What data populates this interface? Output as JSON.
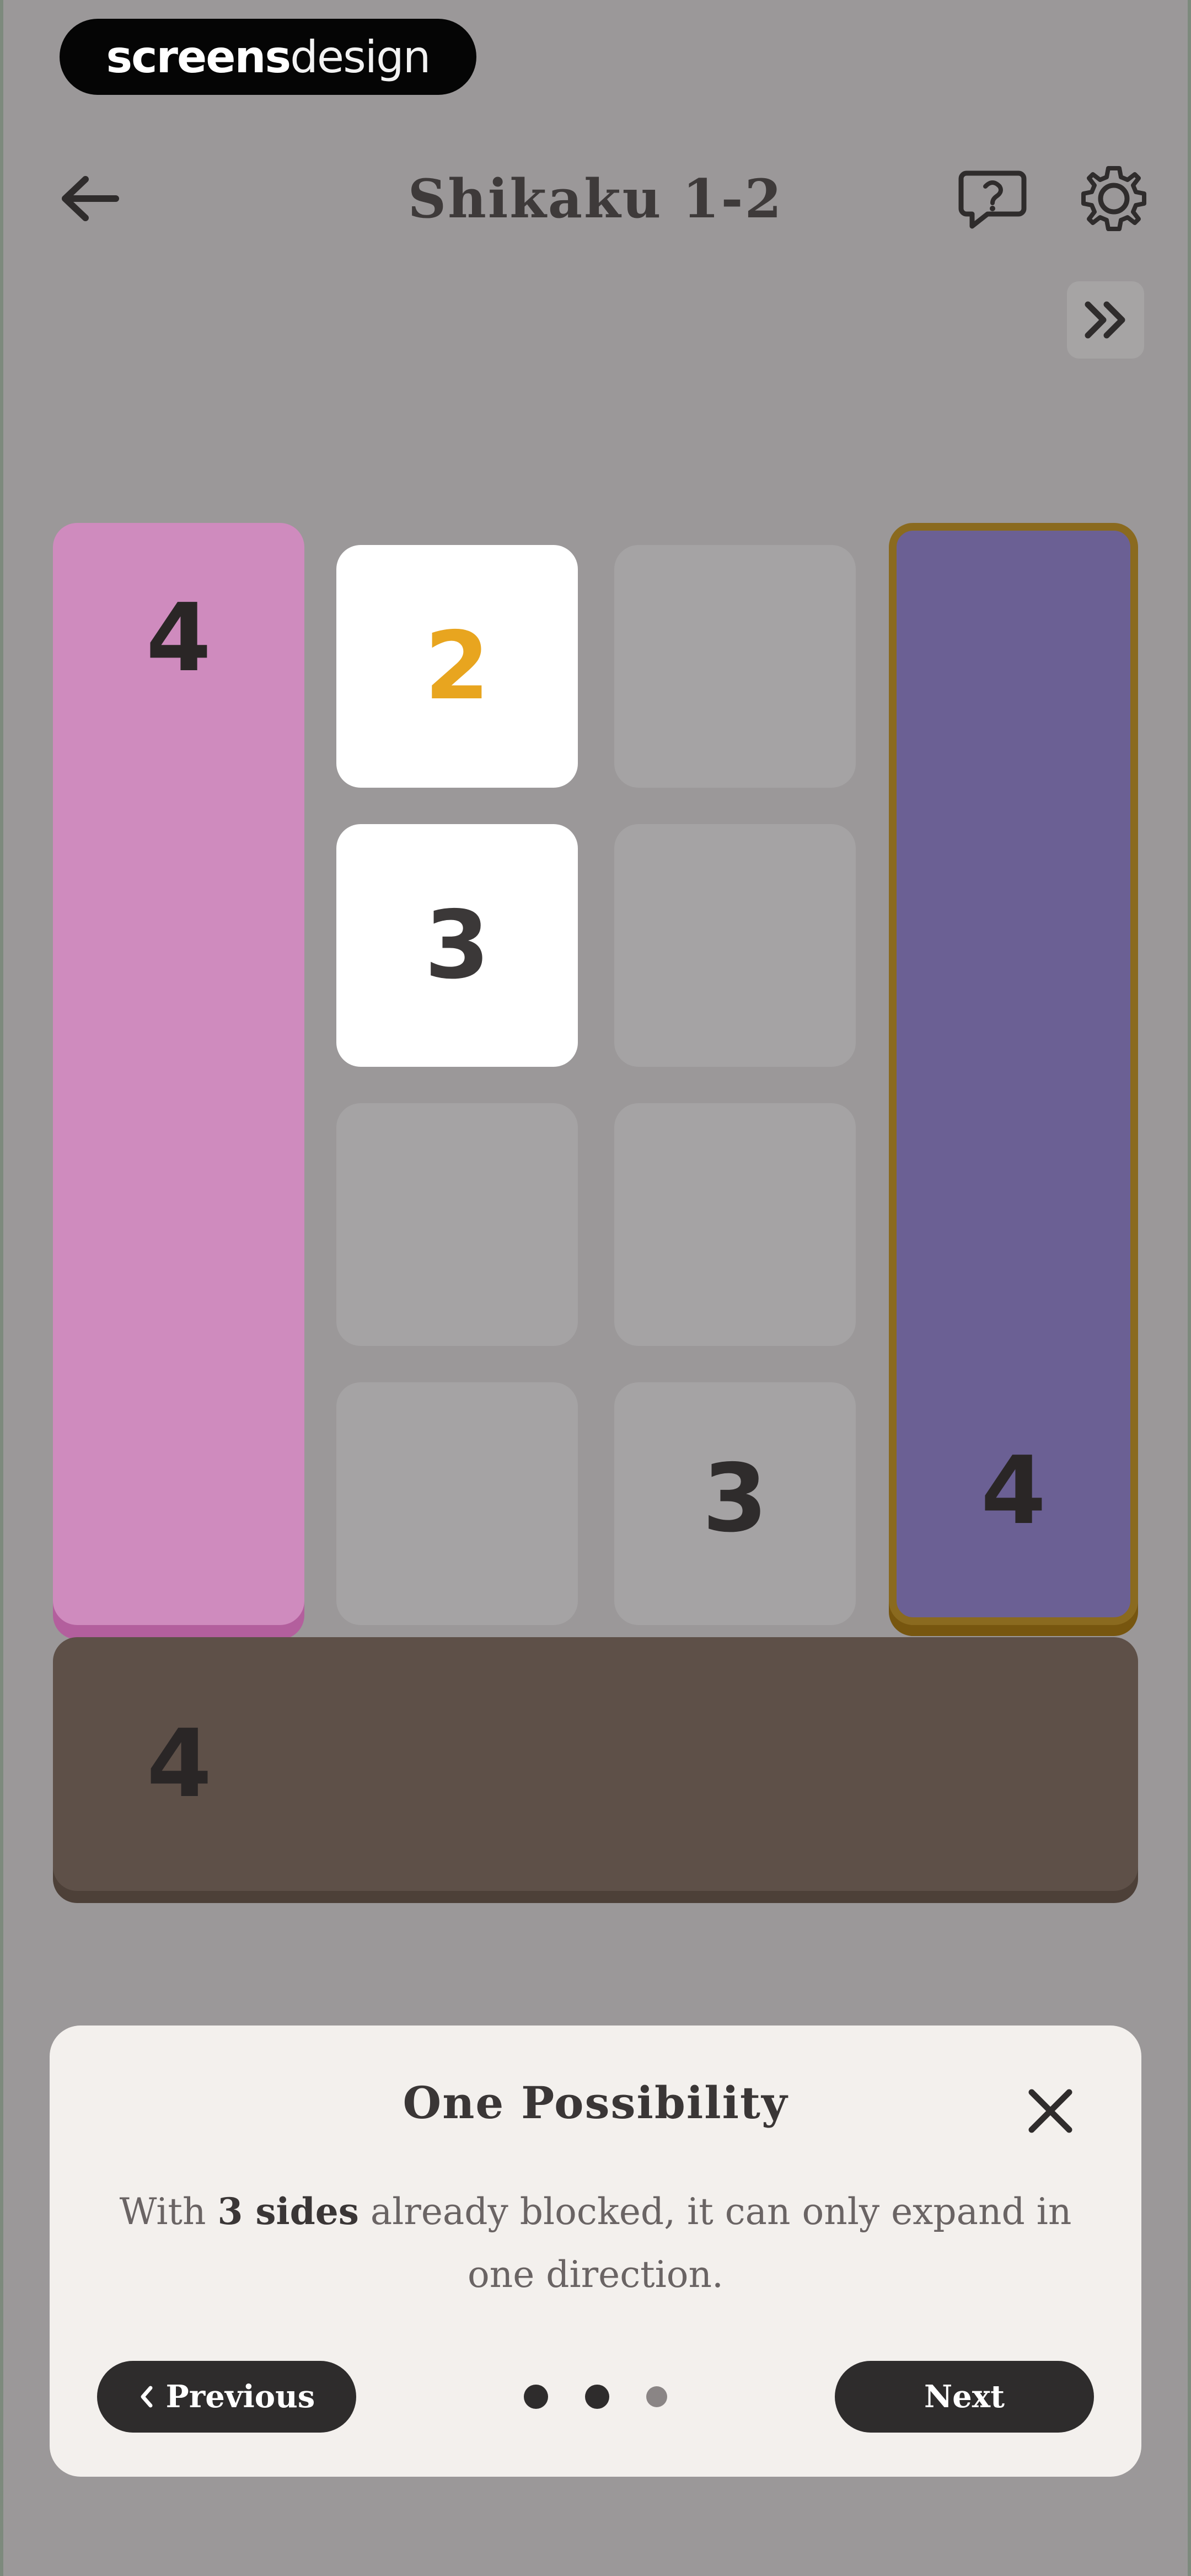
{
  "brand": {
    "part1": "screens",
    "part2": "design"
  },
  "header": {
    "title": "Shikaku 1-2",
    "back_icon": "arrow-left-icon",
    "help_icon": "chat-question-icon",
    "settings_icon": "gear-icon",
    "skip_icon": "double-chevron-right-icon"
  },
  "board": {
    "pink_block": "4",
    "purple_block": "4",
    "brown_block": "4",
    "cells": {
      "r1c2": "2",
      "r2c2": "3",
      "r4c3": "3"
    }
  },
  "tutorial": {
    "title": "One Possibility",
    "body_prefix": "With ",
    "body_bold": "3 sides",
    "body_suffix": " already blocked, it can only expand in one direction.",
    "previous_label": "Previous",
    "next_label": "Next",
    "page_total": 3,
    "page_current": 2
  },
  "colors": {
    "pink": "#cf8bbe",
    "purple": "#6b6094",
    "brown": "#5e5048",
    "accent_orange": "#e8a51f"
  }
}
